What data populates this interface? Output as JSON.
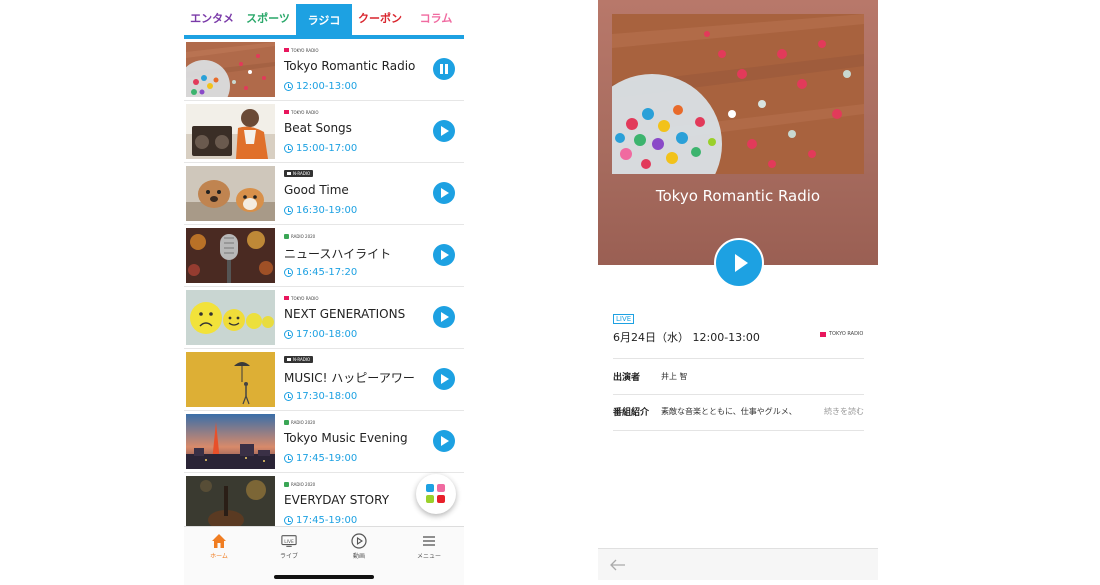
{
  "tabs": [
    {
      "label": "エンタメ",
      "color": "#7a3aa8"
    },
    {
      "label": "スポーツ",
      "color": "#2aa86a"
    },
    {
      "label": "ラジコ",
      "color": "#ffffff"
    },
    {
      "label": "クーポン",
      "color": "#d9262e"
    },
    {
      "label": "コラム",
      "color": "#f06aa0"
    }
  ],
  "programs": [
    {
      "station": "TOKYO RADIO",
      "title": "Tokyo Romantic Radio",
      "time": "12:00-13:00",
      "state": "playing",
      "thumb_icon": "confetti-jar-image"
    },
    {
      "station": "TOKYO RADIO",
      "title": "Beat Songs",
      "time": "15:00-17:00",
      "state": "stopped",
      "thumb_icon": "boombox-child-image"
    },
    {
      "station": "N-RADIO",
      "title": "Good Time",
      "time": "16:30-19:00",
      "state": "stopped",
      "thumb_icon": "dogs-image"
    },
    {
      "station": "RADIO 2020",
      "title": "ニュースハイライト",
      "time": "16:45-17:20",
      "state": "stopped",
      "thumb_icon": "microphone-image"
    },
    {
      "station": "TOKYO RADIO",
      "title": "NEXT GENERATIONS",
      "time": "17:00-18:00",
      "state": "stopped",
      "thumb_icon": "emoji-balls-image"
    },
    {
      "station": "N-RADIO",
      "title": "MUSIC! ハッピーアワー",
      "time": "17:30-18:00",
      "state": "stopped",
      "thumb_icon": "umbrella-wall-image"
    },
    {
      "station": "RADIO 2020",
      "title": "Tokyo Music Evening",
      "time": "17:45-19:00",
      "state": "stopped",
      "thumb_icon": "tokyo-tower-image"
    },
    {
      "station": "RADIO 2020",
      "title": "EVERYDAY STORY",
      "time": "17:45-19:00",
      "state": "stopped",
      "thumb_icon": "guitar-image"
    }
  ],
  "bottom_nav": [
    {
      "label": "ホーム",
      "icon": "home-icon"
    },
    {
      "label": "ライブ",
      "icon": "live-icon"
    },
    {
      "label": "動画",
      "icon": "video-play-icon"
    },
    {
      "label": "メニュー",
      "icon": "menu-icon"
    }
  ],
  "detail": {
    "title": "Tokyo Romantic Radio",
    "live_label": "LIVE",
    "airtime": "6月24日（水） 12:00-13:00",
    "station": "TOKYO RADIO",
    "performer_label": "出演者",
    "performer_value": "井上 智",
    "intro_label": "番組紹介",
    "intro_value": "素敵な音楽とともに、仕事やグルメ、",
    "read_more": "続きを読む"
  },
  "colors": {
    "accent": "#1da1e2",
    "home_active": "#f07d22",
    "station_pink": "#e8175d",
    "station_green": "#3aa655"
  }
}
